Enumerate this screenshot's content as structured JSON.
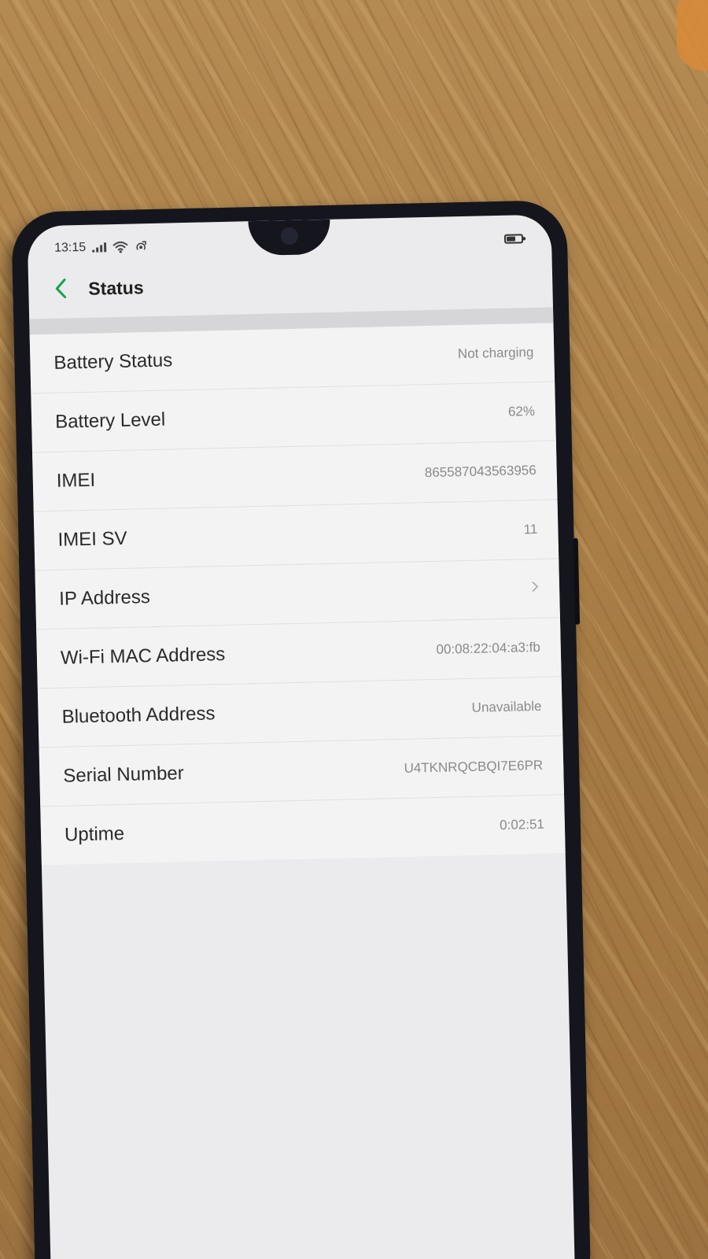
{
  "status_bar": {
    "time": "13:15",
    "signal_icon": "signal-bars-icon",
    "wifi_icon": "wifi-icon",
    "extra_icon": "hotspot-icon",
    "battery_icon": "battery-icon",
    "battery_fill_fraction": 0.62
  },
  "header": {
    "back_icon": "chevron-left-icon",
    "title": "Status"
  },
  "accent_color": "#17a34a",
  "rows": [
    {
      "label": "Battery Status",
      "value": "Not charging"
    },
    {
      "label": "Battery Level",
      "value": "62%"
    },
    {
      "label": "IMEI",
      "value": "865587043563956"
    },
    {
      "label": "IMEI SV",
      "value": "11"
    },
    {
      "label": "IP Address",
      "value": ""
    },
    {
      "label": "Wi-Fi MAC Address",
      "value": "00:08:22:04:a3:fb"
    },
    {
      "label": "Bluetooth Address",
      "value": "Unavailable"
    },
    {
      "label": "Serial Number",
      "value": "U4TKNRQCBQI7E6PR"
    },
    {
      "label": "Uptime",
      "value": "0:02:51"
    }
  ]
}
